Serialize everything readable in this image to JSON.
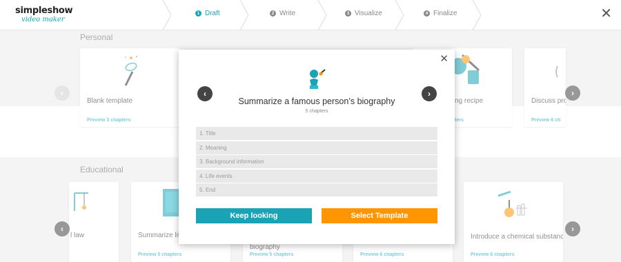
{
  "app": {
    "logo_main": "simpleshow",
    "logo_sub": "video maker"
  },
  "steps": [
    {
      "num": "1",
      "label": "Draft"
    },
    {
      "num": "2",
      "label": "Write"
    },
    {
      "num": "3",
      "label": "Visualize"
    },
    {
      "num": "4",
      "label": "Finalize"
    }
  ],
  "personal": {
    "title": "Personal",
    "cards": [
      {
        "title": "Blank template",
        "link": "Preview 3 chapters"
      },
      {
        "title": "ng recipe",
        "link": "ters"
      },
      {
        "title": "Discuss pro",
        "link": "Preview 6 ch"
      }
    ]
  },
  "educational": {
    "title": "Educational",
    "cards": [
      {
        "title": "l law",
        "link": ""
      },
      {
        "title": "Summarize liter",
        "link": "Preview 5 chapters"
      },
      {
        "title": "biography",
        "link": "Preview 5 chapters"
      },
      {
        "title": "",
        "link": "Preview 6 chapters"
      },
      {
        "title": "Introduce a chemical substance",
        "link": "Preview 6 chapters"
      }
    ]
  },
  "modal": {
    "title": "Summarize a famous person’s biography",
    "subtitle": "5 chapters",
    "chapters": [
      "1. Title",
      "2. Meaning",
      "3. Background information",
      "4. Life events",
      "5. End"
    ],
    "keep_label": "Keep looking",
    "select_label": "Select Template"
  },
  "colors": {
    "accent": "#1aa3b5",
    "select": "#ff9500"
  }
}
